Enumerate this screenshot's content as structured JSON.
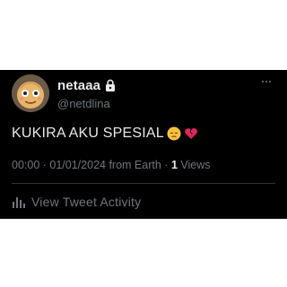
{
  "user": {
    "display_name": "netaaa",
    "handle": "@netdlina",
    "avatar_icon": "avatar-cartoon-face",
    "protected_icon": "lock-icon"
  },
  "tweet": {
    "text": "KUKIRA AKU SPESIAL",
    "emojis": [
      "pensive-face-emoji",
      "broken-heart-emoji"
    ],
    "time": "00:00",
    "date": "01/01/2024",
    "source": "from Earth",
    "views_count": "1",
    "views_label": "Views"
  },
  "actions": {
    "more_icon": "more-horizontal-icon",
    "activity_label": "View Tweet Activity",
    "activity_icon": "bar-chart-icon"
  },
  "colors": {
    "background": "#000000",
    "text": "#e7e9ea",
    "secondary": "#71767b",
    "divider": "#2f3336"
  }
}
